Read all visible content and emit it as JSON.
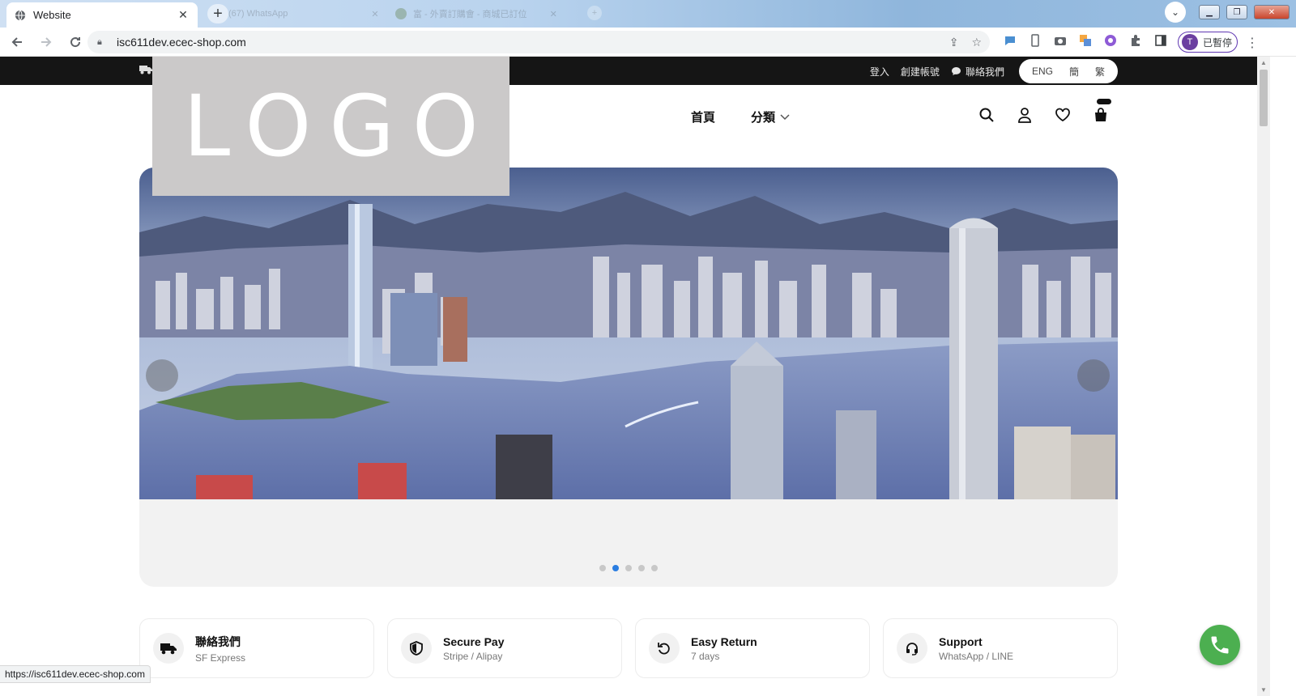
{
  "browser": {
    "active_tab_title": "Website",
    "ghost_tabs": [
      "(67) WhatsApp",
      "富 - 外賣訂購會 - 商城已訂位"
    ],
    "url": "isc611dev.ecec-shop.com",
    "profile_label": "已暫停",
    "profile_initial": "T",
    "status_url": "https://isc611dev.ecec-shop.com"
  },
  "topbar": {
    "login": "登入",
    "register": "創建帳號",
    "contact": "聯絡我們",
    "languages": [
      "ENG",
      "簡",
      "繁"
    ]
  },
  "logo_text": "LOGO",
  "nav": {
    "home": "首頁",
    "categories": "分類"
  },
  "hero": {
    "slide_count": 5,
    "active_slide": 2
  },
  "features": [
    {
      "title": "聯絡我們",
      "subtitle": "SF Express",
      "icon": "truck-icon"
    },
    {
      "title": "Secure Pay",
      "subtitle": "Stripe / Alipay",
      "icon": "shield-icon"
    },
    {
      "title": "Easy Return",
      "subtitle": "7 days",
      "icon": "return-icon"
    },
    {
      "title": "Support",
      "subtitle": "WhatsApp / LINE",
      "icon": "headset-icon"
    }
  ],
  "colors": {
    "topbar": "#151515",
    "accent_dot": "#2a7de1",
    "call_button": "#4caf50"
  }
}
